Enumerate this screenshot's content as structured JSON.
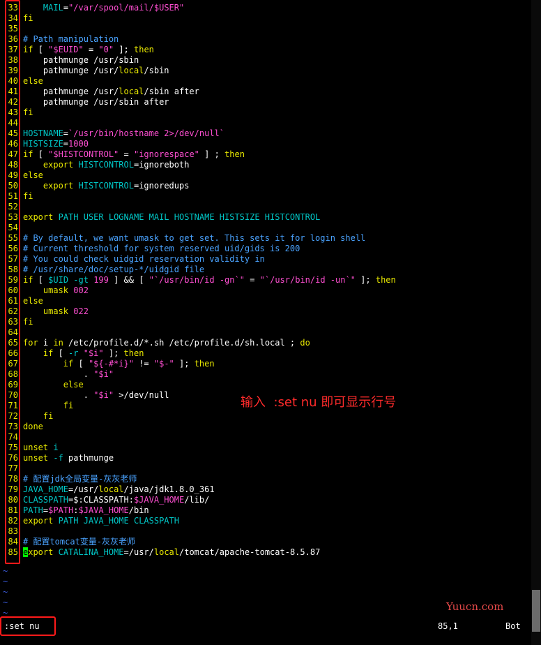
{
  "colors": {
    "comment": "#4aa3ff",
    "keyword": "#e8e800",
    "variable": "#00c8c8",
    "string": "#ff4fd2",
    "number": "#ff4fd2",
    "plain": "#ffffff",
    "line_number": "#e8e800",
    "annotation": "#ff2b2b",
    "highlight_box": "#ff1a1a"
  },
  "lines": [
    {
      "n": "33",
      "segs": [
        [
          "plain",
          "    "
        ],
        [
          "variable",
          "MAIL"
        ],
        [
          "plain",
          "="
        ],
        [
          "string",
          "\"/var/spool/mail/$USER\""
        ]
      ]
    },
    {
      "n": "34",
      "segs": [
        [
          "keyword",
          "fi"
        ]
      ]
    },
    {
      "n": "35",
      "segs": []
    },
    {
      "n": "36",
      "segs": [
        [
          "comment",
          "# Path manipulation"
        ]
      ]
    },
    {
      "n": "37",
      "segs": [
        [
          "keyword",
          "if"
        ],
        [
          "plain",
          " [ "
        ],
        [
          "string",
          "\"$EUID\""
        ],
        [
          "plain",
          " = "
        ],
        [
          "string",
          "\"0\""
        ],
        [
          "plain",
          " ]; "
        ],
        [
          "keyword",
          "then"
        ]
      ]
    },
    {
      "n": "38",
      "segs": [
        [
          "plain",
          "    pathmunge /usr/sbin"
        ]
      ]
    },
    {
      "n": "39",
      "segs": [
        [
          "plain",
          "    pathmunge /usr/"
        ],
        [
          "keyword",
          "local"
        ],
        [
          "plain",
          "/sbin"
        ]
      ]
    },
    {
      "n": "40",
      "segs": [
        [
          "keyword",
          "else"
        ]
      ]
    },
    {
      "n": "41",
      "segs": [
        [
          "plain",
          "    pathmunge /usr/"
        ],
        [
          "keyword",
          "local"
        ],
        [
          "plain",
          "/sbin after"
        ]
      ]
    },
    {
      "n": "42",
      "segs": [
        [
          "plain",
          "    pathmunge /usr/sbin after"
        ]
      ]
    },
    {
      "n": "43",
      "segs": [
        [
          "keyword",
          "fi"
        ]
      ]
    },
    {
      "n": "44",
      "segs": []
    },
    {
      "n": "45",
      "segs": [
        [
          "variable",
          "HOSTNAME"
        ],
        [
          "plain",
          "="
        ],
        [
          "string",
          "`/usr/bin/hostname 2>/dev/null`"
        ]
      ]
    },
    {
      "n": "46",
      "segs": [
        [
          "variable",
          "HISTSIZE"
        ],
        [
          "plain",
          "="
        ],
        [
          "number",
          "1000"
        ]
      ]
    },
    {
      "n": "47",
      "segs": [
        [
          "keyword",
          "if"
        ],
        [
          "plain",
          " [ "
        ],
        [
          "string",
          "\"$HISTCONTROL\""
        ],
        [
          "plain",
          " = "
        ],
        [
          "string",
          "\"ignorespace\""
        ],
        [
          "plain",
          " ] ; "
        ],
        [
          "keyword",
          "then"
        ]
      ]
    },
    {
      "n": "48",
      "segs": [
        [
          "plain",
          "    "
        ],
        [
          "keyword",
          "export"
        ],
        [
          "plain",
          " "
        ],
        [
          "variable",
          "HISTCONTROL"
        ],
        [
          "plain",
          "=ignoreboth"
        ]
      ]
    },
    {
      "n": "49",
      "segs": [
        [
          "keyword",
          "else"
        ]
      ]
    },
    {
      "n": "50",
      "segs": [
        [
          "plain",
          "    "
        ],
        [
          "keyword",
          "export"
        ],
        [
          "plain",
          " "
        ],
        [
          "variable",
          "HISTCONTROL"
        ],
        [
          "plain",
          "=ignoredups"
        ]
      ]
    },
    {
      "n": "51",
      "segs": [
        [
          "keyword",
          "fi"
        ]
      ]
    },
    {
      "n": "52",
      "segs": []
    },
    {
      "n": "53",
      "segs": [
        [
          "keyword",
          "export"
        ],
        [
          "plain",
          " "
        ],
        [
          "variable",
          "PATH USER LOGNAME MAIL HOSTNAME HISTSIZE HISTCONTROL"
        ]
      ]
    },
    {
      "n": "54",
      "segs": []
    },
    {
      "n": "55",
      "segs": [
        [
          "comment",
          "# By default, we want umask to get set. This sets it for login shell"
        ]
      ]
    },
    {
      "n": "56",
      "segs": [
        [
          "comment",
          "# Current threshold for system reserved uid/gids is 200"
        ]
      ]
    },
    {
      "n": "57",
      "segs": [
        [
          "comment",
          "# You could check uidgid reservation validity in"
        ]
      ]
    },
    {
      "n": "58",
      "segs": [
        [
          "comment",
          "# /usr/share/doc/setup-*/uidgid file"
        ]
      ]
    },
    {
      "n": "59",
      "segs": [
        [
          "keyword",
          "if"
        ],
        [
          "plain",
          " [ "
        ],
        [
          "variable",
          "$UID"
        ],
        [
          "plain",
          " "
        ],
        [
          "variable",
          "-gt"
        ],
        [
          "plain",
          " "
        ],
        [
          "number",
          "199"
        ],
        [
          "plain",
          " ] && [ "
        ],
        [
          "string",
          "\"`/usr/bin/id -gn`\""
        ],
        [
          "plain",
          " = "
        ],
        [
          "string",
          "\"`/usr/bin/id -un`\""
        ],
        [
          "plain",
          " ]; "
        ],
        [
          "keyword",
          "then"
        ]
      ]
    },
    {
      "n": "60",
      "segs": [
        [
          "plain",
          "    "
        ],
        [
          "keyword",
          "umask"
        ],
        [
          "plain",
          " "
        ],
        [
          "number",
          "002"
        ]
      ]
    },
    {
      "n": "61",
      "segs": [
        [
          "keyword",
          "else"
        ]
      ]
    },
    {
      "n": "62",
      "segs": [
        [
          "plain",
          "    "
        ],
        [
          "keyword",
          "umask"
        ],
        [
          "plain",
          " "
        ],
        [
          "number",
          "022"
        ]
      ]
    },
    {
      "n": "63",
      "segs": [
        [
          "keyword",
          "fi"
        ]
      ]
    },
    {
      "n": "64",
      "segs": []
    },
    {
      "n": "65",
      "segs": [
        [
          "keyword",
          "for"
        ],
        [
          "plain",
          " i "
        ],
        [
          "keyword",
          "in"
        ],
        [
          "plain",
          " /etc/profile.d/*.sh /etc/profile.d/sh.local ; "
        ],
        [
          "keyword",
          "do"
        ]
      ]
    },
    {
      "n": "66",
      "segs": [
        [
          "plain",
          "    "
        ],
        [
          "keyword",
          "if"
        ],
        [
          "plain",
          " [ "
        ],
        [
          "variable",
          "-r"
        ],
        [
          "plain",
          " "
        ],
        [
          "string",
          "\"$i\""
        ],
        [
          "plain",
          " ]; "
        ],
        [
          "keyword",
          "then"
        ]
      ]
    },
    {
      "n": "67",
      "segs": [
        [
          "plain",
          "        "
        ],
        [
          "keyword",
          "if"
        ],
        [
          "plain",
          " [ "
        ],
        [
          "string",
          "\"${-#*i}\""
        ],
        [
          "plain",
          " != "
        ],
        [
          "string",
          "\"$-\""
        ],
        [
          "plain",
          " ]; "
        ],
        [
          "keyword",
          "then"
        ]
      ]
    },
    {
      "n": "68",
      "segs": [
        [
          "plain",
          "            . "
        ],
        [
          "string",
          "\"$i\""
        ]
      ]
    },
    {
      "n": "69",
      "segs": [
        [
          "plain",
          "        "
        ],
        [
          "keyword",
          "else"
        ]
      ]
    },
    {
      "n": "70",
      "segs": [
        [
          "plain",
          "            . "
        ],
        [
          "string",
          "\"$i\""
        ],
        [
          "plain",
          " >/dev/null"
        ]
      ]
    },
    {
      "n": "71",
      "segs": [
        [
          "plain",
          "        "
        ],
        [
          "keyword",
          "fi"
        ]
      ]
    },
    {
      "n": "72",
      "segs": [
        [
          "plain",
          "    "
        ],
        [
          "keyword",
          "fi"
        ]
      ]
    },
    {
      "n": "73",
      "segs": [
        [
          "keyword",
          "done"
        ]
      ]
    },
    {
      "n": "74",
      "segs": []
    },
    {
      "n": "75",
      "segs": [
        [
          "keyword",
          "unset"
        ],
        [
          "plain",
          " "
        ],
        [
          "variable",
          "i"
        ]
      ]
    },
    {
      "n": "76",
      "segs": [
        [
          "keyword",
          "unset"
        ],
        [
          "plain",
          " "
        ],
        [
          "variable",
          "-f"
        ],
        [
          "plain",
          " pathmunge"
        ]
      ]
    },
    {
      "n": "77",
      "segs": []
    },
    {
      "n": "78",
      "segs": [
        [
          "comment",
          "# 配置jdk全局变量-灰灰老师"
        ]
      ]
    },
    {
      "n": "79",
      "segs": [
        [
          "variable",
          "JAVA_HOME"
        ],
        [
          "plain",
          "=/usr/"
        ],
        [
          "keyword",
          "local"
        ],
        [
          "plain",
          "/java/jdk1.8.0_361"
        ]
      ]
    },
    {
      "n": "80",
      "segs": [
        [
          "variable",
          "CLASSPATH"
        ],
        [
          "plain",
          "=$:CLASSPATH:"
        ],
        [
          "string",
          "$JAVA_HOME"
        ],
        [
          "plain",
          "/lib/"
        ]
      ]
    },
    {
      "n": "81",
      "segs": [
        [
          "variable",
          "PATH"
        ],
        [
          "plain",
          "="
        ],
        [
          "string",
          "$PATH"
        ],
        [
          "plain",
          ":"
        ],
        [
          "string",
          "$JAVA_HOME"
        ],
        [
          "plain",
          "/bin"
        ]
      ]
    },
    {
      "n": "82",
      "segs": [
        [
          "keyword",
          "export"
        ],
        [
          "plain",
          " "
        ],
        [
          "variable",
          "PATH JAVA_HOME CLASSPATH"
        ]
      ]
    },
    {
      "n": "83",
      "segs": []
    },
    {
      "n": "84",
      "segs": [
        [
          "comment",
          "# 配置tomcat变量-灰灰老师"
        ]
      ]
    },
    {
      "n": "85",
      "segs": [
        [
          "cursor",
          "e"
        ],
        [
          "keyword",
          "xport"
        ],
        [
          "plain",
          " "
        ],
        [
          "variable",
          "CATALINA_HOME"
        ],
        [
          "plain",
          "=/usr/"
        ],
        [
          "keyword",
          "local"
        ],
        [
          "plain",
          "/tomcat/apache-tomcat-8.5.87"
        ]
      ]
    }
  ],
  "tilde_lines": [
    "~",
    "~",
    "~",
    "~",
    "~"
  ],
  "status": {
    "command": ":set nu",
    "position": "85,1",
    "scroll": "Bot"
  },
  "annotation": "输入  :set nu 即可显示行号",
  "watermark": "Yuucn.com"
}
